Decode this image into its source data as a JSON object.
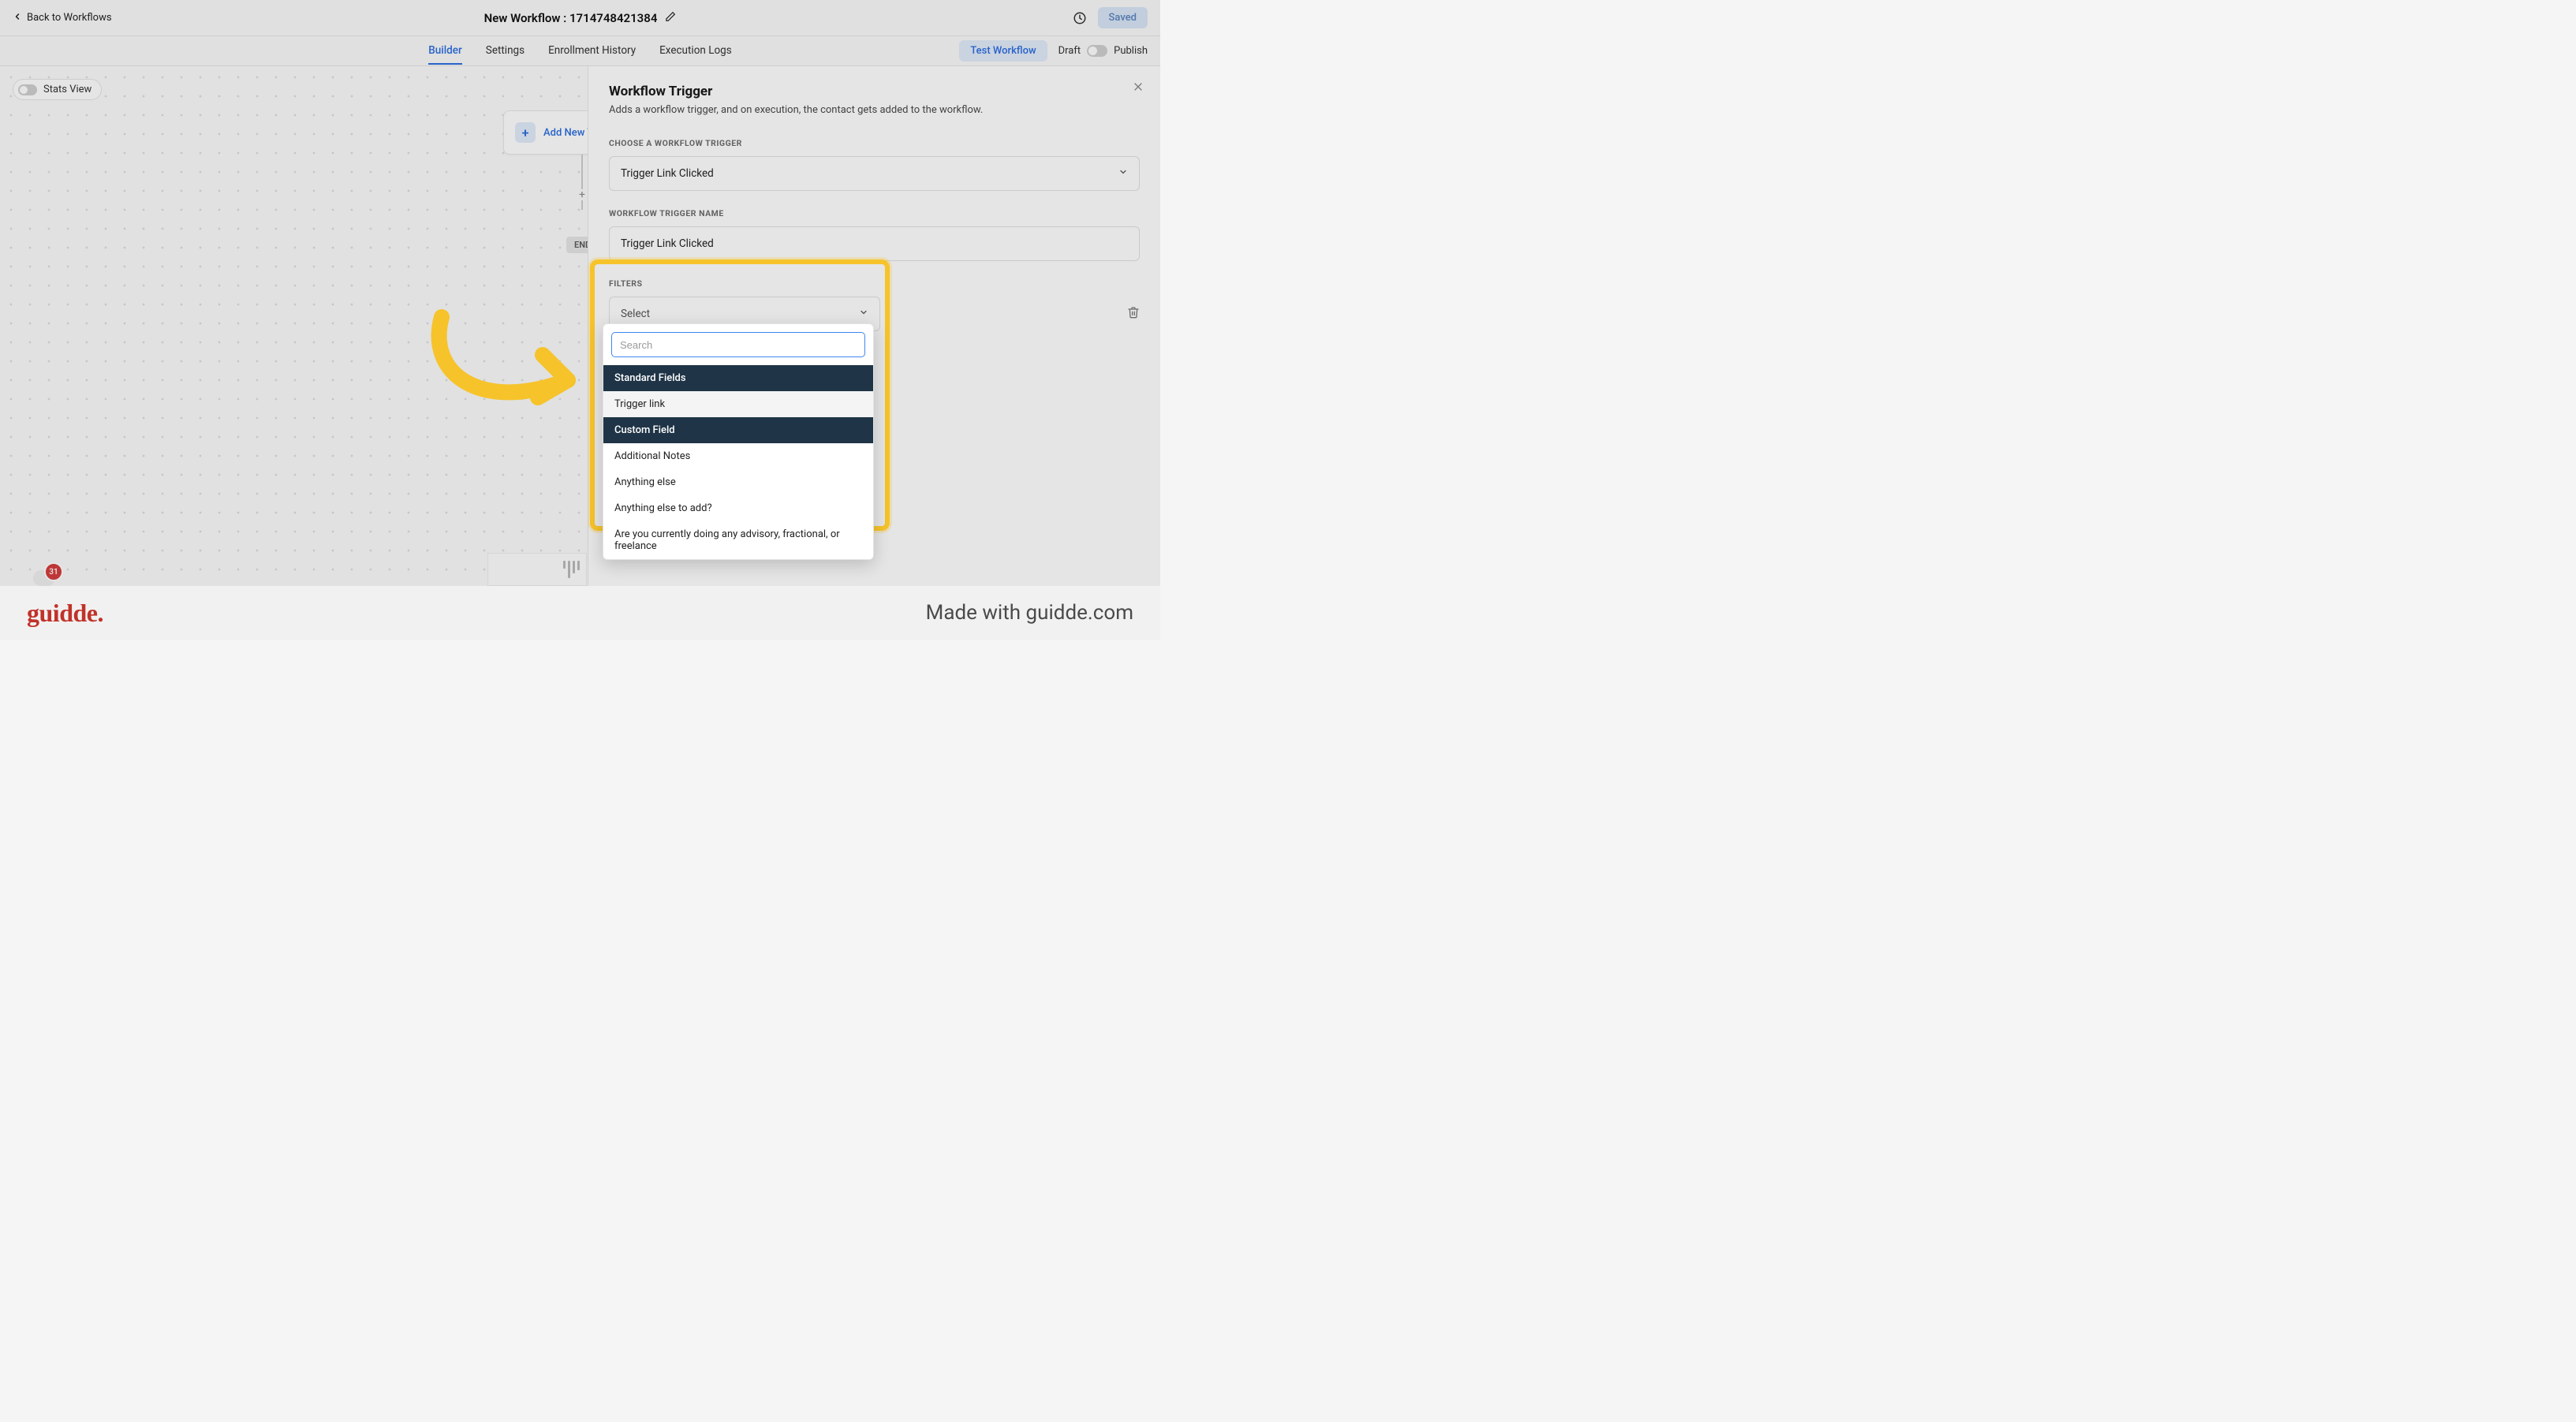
{
  "topbar": {
    "back_label": "Back to Workflows",
    "title": "New Workflow : 1714748421384",
    "saved_label": "Saved"
  },
  "tabs": {
    "builder": "Builder",
    "settings": "Settings",
    "enrollment": "Enrollment History",
    "execution": "Execution Logs",
    "test_workflow": "Test Workflow",
    "draft": "Draft",
    "publish": "Publish"
  },
  "canvas": {
    "stats_view": "Stats View",
    "add_trigger": "Add New Trig",
    "end_label": "END",
    "badge_count": "31"
  },
  "panel": {
    "title": "Workflow Trigger",
    "description": "Adds a workflow trigger, and on execution, the contact gets added to the workflow.",
    "choose_label": "CHOOSE A WORKFLOW TRIGGER",
    "trigger_value": "Trigger Link Clicked",
    "name_label": "WORKFLOW TRIGGER NAME",
    "name_value": "Trigger Link Clicked",
    "filters_label": "FILTERS",
    "filter_select_placeholder": "Select"
  },
  "dropdown": {
    "search_placeholder": "Search",
    "group1": "Standard Fields",
    "item1": "Trigger link",
    "group2": "Custom Field",
    "item2": "Additional Notes",
    "item3": "Anything else",
    "item4": "Anything else to add?",
    "item5": "Are you currently doing any advisory, fractional, or freelance"
  },
  "footer": {
    "logo": "guidde",
    "right": "Made with guidde.com"
  }
}
